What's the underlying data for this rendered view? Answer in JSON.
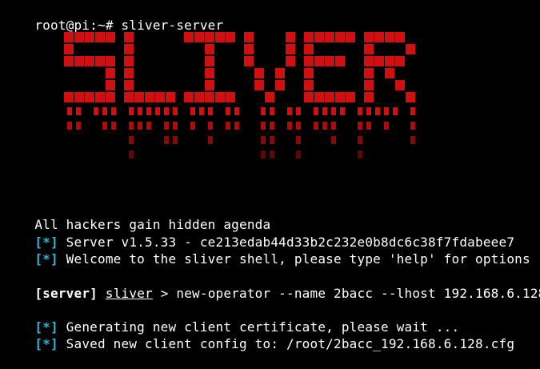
{
  "prompt": {
    "text": "root@pi:~# sliver-server"
  },
  "banner": {
    "word": "SLIVER",
    "color": "#d01010"
  },
  "tagline": "All hackers gain hidden agenda",
  "info_lines": [
    {
      "tag": "[*]",
      "text": " Server v1.5.33 - ce213edab44d33b2c232e0b8dc6c38f7fdabeee7"
    },
    {
      "tag": "[*]",
      "text": " Welcome to the sliver shell, please type 'help' for options"
    }
  ],
  "command": {
    "context": "[server]",
    "prompt": "sliver",
    "separator": " > ",
    "text": "new-operator --name 2bacc --lhost 192.168.6.128"
  },
  "output_lines": [
    {
      "tag": "[*]",
      "text": " Generating new client certificate, please wait ..."
    },
    {
      "tag": "[*]",
      "text": " Saved new client config to: /root/2bacc_192.168.6.128.cfg"
    }
  ],
  "colors": {
    "background": "#000000",
    "text": "#ffffff",
    "tag": "#2ab8d8",
    "banner_red": "#d01010"
  }
}
